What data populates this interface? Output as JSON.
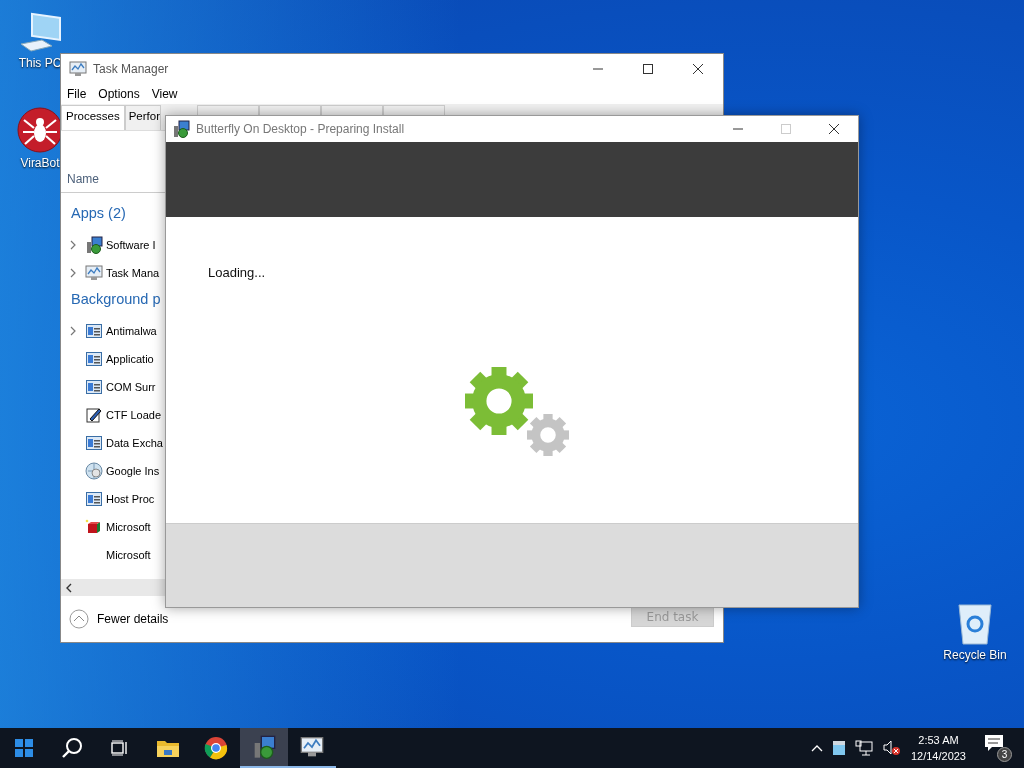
{
  "desktop_icons": [
    {
      "label": "This PC",
      "kind": "computer"
    },
    {
      "label": "ViraBot",
      "kind": "spider"
    },
    {
      "label": "Recycle Bin",
      "kind": "bin"
    }
  ],
  "task_manager": {
    "title": "Task Manager",
    "menu": [
      "File",
      "Options",
      "View"
    ],
    "tabs": [
      {
        "label": "Processes",
        "selected": true
      },
      {
        "label": "Perfor",
        "selected": false
      }
    ],
    "column": "Name",
    "groups": [
      {
        "title": "Apps (2)",
        "rows": [
          {
            "name": "Software I",
            "kind": "installer",
            "expandable": true
          },
          {
            "name": "Task Mana",
            "kind": "monitor",
            "expandable": true
          }
        ]
      },
      {
        "title": "Background p",
        "rows": [
          {
            "name": "Antimalwa",
            "kind": "window",
            "expandable": true
          },
          {
            "name": "Applicatio",
            "kind": "window",
            "expandable": false
          },
          {
            "name": "COM Surr",
            "kind": "window",
            "expandable": false
          },
          {
            "name": "CTF Loade",
            "kind": "pen",
            "expandable": false
          },
          {
            "name": "Data Excha",
            "kind": "window",
            "expandable": false
          },
          {
            "name": "Google Ins",
            "kind": "globe",
            "expandable": false
          },
          {
            "name": "Host Proc",
            "kind": "window",
            "expandable": false
          },
          {
            "name": "Microsoft",
            "kind": "cube",
            "expandable": false
          },
          {
            "name": "Microsoft",
            "kind": "none",
            "expandable": false
          }
        ]
      }
    ],
    "fewer_details": "Fewer details",
    "end_task": {
      "label": "End task",
      "disabled": true
    }
  },
  "dialog": {
    "title": "Butterfly On Desktop - Preparing Install",
    "status": "Loading..."
  },
  "taskbar": {
    "apps": [
      {
        "kind": "folder",
        "selected": false,
        "running": false
      },
      {
        "kind": "browser",
        "selected": false,
        "running": false
      },
      {
        "kind": "installer",
        "selected": true,
        "running": true
      },
      {
        "kind": "monitor",
        "selected": false,
        "running": true
      }
    ],
    "time": "2:53 AM",
    "date": "12/14/2023",
    "notifications": "3"
  }
}
